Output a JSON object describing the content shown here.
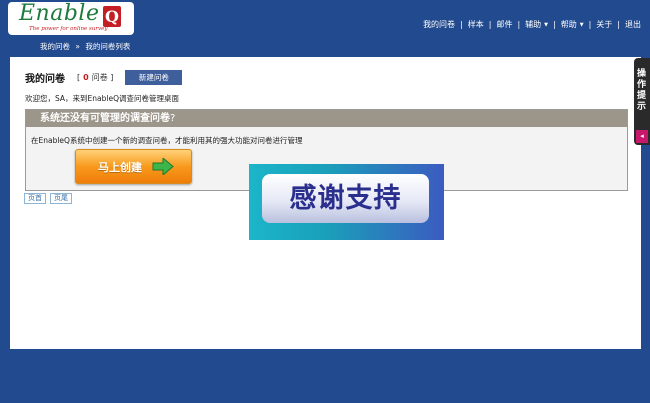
{
  "logo": {
    "text": "Enable",
    "q": "Q",
    "tagline": "The power for online survey"
  },
  "nav": {
    "items": [
      "我的问卷",
      "样本",
      "邮件",
      "辅助",
      "帮助",
      "关于",
      "退出"
    ]
  },
  "breadcrumb": {
    "home": "我的问卷",
    "separator": "»",
    "current": "我的问卷列表"
  },
  "main": {
    "title": "我的问卷",
    "count_open": "[",
    "count_value": "0",
    "count_unit": "问卷",
    "count_close": "]",
    "new_button": "新建问卷",
    "welcome": "欢迎您，SA，来到EnableQ调查问卷管理桌面",
    "empty_title": "系统还没有可管理的调查问卷",
    "empty_title_mark": "?",
    "empty_desc": "在EnableQ系统中创建一个新的调查问卷，才能利用其的强大功能对问卷进行管理",
    "create_button": "马上创建"
  },
  "pager": {
    "first": "页首",
    "last": "页尾"
  },
  "overlay": {
    "text": "感谢支持"
  },
  "side_tab": {
    "label": "操作提示",
    "toggle": "◂"
  },
  "colors": {
    "background": "#224a8e",
    "accent_red": "#c41e24",
    "button_orange": "#f89a1c",
    "bar_gray": "#9c9589"
  }
}
